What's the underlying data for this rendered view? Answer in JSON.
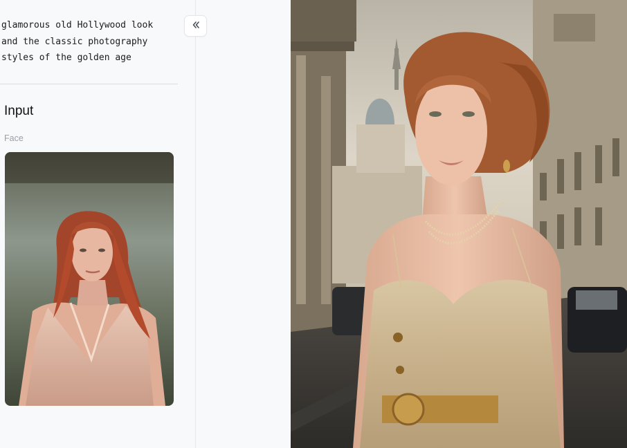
{
  "prompt": {
    "text": "glamorous old Hollywood look\nand the classic photography\nstyles of the golden age"
  },
  "input_section": {
    "title": "Input",
    "face_label": "Face"
  },
  "sidebar_toggle": {
    "icon": "chevrons-left-icon"
  }
}
